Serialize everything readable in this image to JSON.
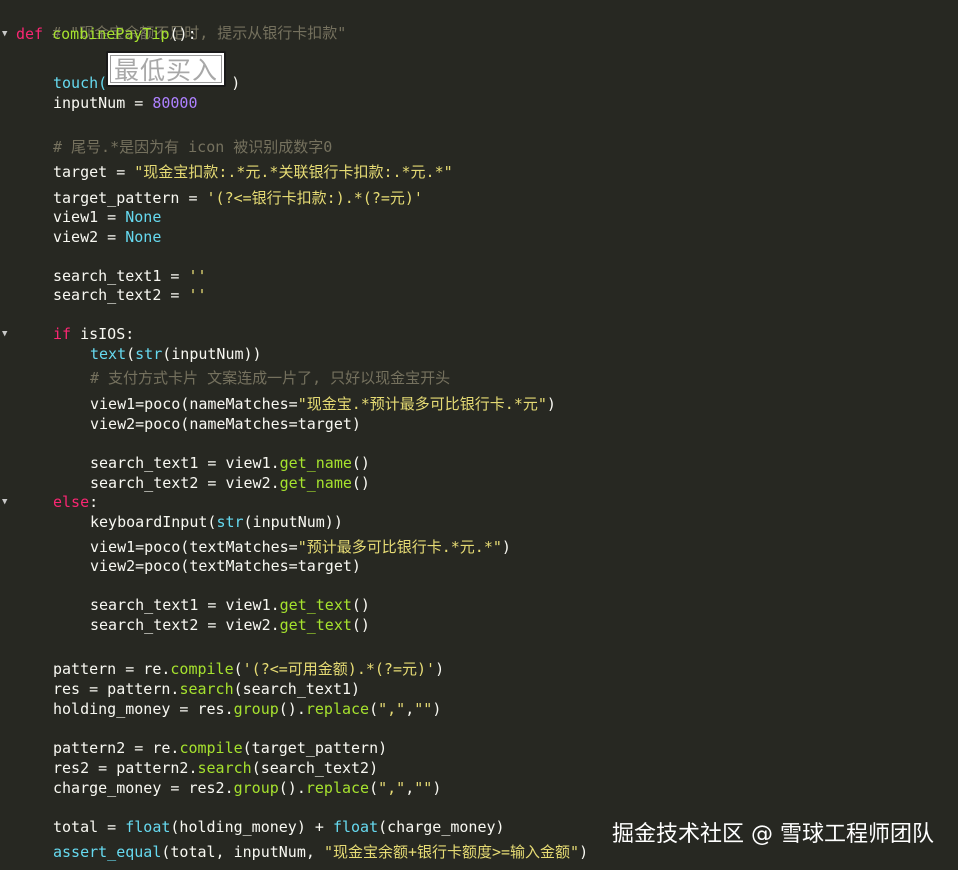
{
  "code": {
    "l01": "# \"现金宝余额不足时, 提示从银行卡扣款\"",
    "l02_kw": "def",
    "l02_fn": "combinePayTip",
    "l02_rest": "():",
    "l03_pre": "touch(",
    "l03_post": ")",
    "l04_pre": "inputNum = ",
    "l04_num": "80000",
    "l05": "# 尾号.*是因为有 icon 被识别成数字0",
    "l06_pre": "target = ",
    "l06_str": "\"现金宝扣款:.*元.*关联银行卡扣款:.*元.*\"",
    "l07_pre": "target_pattern = ",
    "l07_str": "'(?<=银行卡扣款:).*(?=元)'",
    "l08_pre": "view1 = ",
    "l08_none": "None",
    "l09_pre": "view2 = ",
    "l09_none": "None",
    "l10_pre": "search_text1 = ",
    "l10_str": "''",
    "l11_pre": "search_text2 = ",
    "l11_str": "''",
    "l12_kw": "if",
    "l12_rest": " isIOS:",
    "l13_fn": "text",
    "l13_open": "(",
    "l13_bi": "str",
    "l13_rest": "(inputNum))",
    "l14": "# 支付方式卡片 文案连成一片了, 只好以现金宝开头",
    "l15_pre": "view1=poco(nameMatches=",
    "l15_str": "\"现金宝.*预计最多可比银行卡.*元\"",
    "l15_post": ")",
    "l16": "view2=poco(nameMatches=target)",
    "l17_pre": "search_text1 = view1.",
    "l17_fn": "get_name",
    "l17_post": "()",
    "l18_pre": "search_text2 = view2.",
    "l18_fn": "get_name",
    "l18_post": "()",
    "l19_kw": "else",
    "l19_rest": ":",
    "l20_pre": "keyboardInput(",
    "l20_bi": "str",
    "l20_rest": "(inputNum))",
    "l21_pre": "view1=poco(textMatches=",
    "l21_str": "\"预计最多可比银行卡.*元.*\"",
    "l21_post": ")",
    "l22": "view2=poco(textMatches=target)",
    "l23_pre": "search_text1 = view1.",
    "l23_fn": "get_text",
    "l23_post": "()",
    "l24_pre": "search_text2 = view2.",
    "l24_fn": "get_text",
    "l24_post": "()",
    "l25_pre": "pattern = re.",
    "l25_fn": "compile",
    "l25_open": "(",
    "l25_str": "'(?<=可用金额).*(?=元)'",
    "l25_post": ")",
    "l26_pre": "res = pattern.",
    "l26_fn": "search",
    "l26_post": "(search_text1)",
    "l27_pre": "holding_money = res.",
    "l27_fn1": "group",
    "l27_mid": "().",
    "l27_fn2": "replace",
    "l27_open": "(",
    "l27_s1": "\",\"",
    "l27_comma": ",",
    "l27_s2": "\"\"",
    "l27_post": ")",
    "l28_pre": "pattern2 = re.",
    "l28_fn": "compile",
    "l28_post": "(target_pattern)",
    "l29_pre": "res2 = pattern2.",
    "l29_fn": "search",
    "l29_post": "(search_text2)",
    "l30_pre": "charge_money = res2.",
    "l30_fn1": "group",
    "l30_mid": "().",
    "l30_fn2": "replace",
    "l30_open": "(",
    "l30_s1": "\",\"",
    "l30_comma": ",",
    "l30_s2": "\"\"",
    "l30_post": ")",
    "l31_pre": "total = ",
    "l31_bi1": "float",
    "l31_mid": "(holding_money) + ",
    "l31_bi2": "float",
    "l31_post": "(charge_money)",
    "l32_bi": "assert_equal",
    "l32_mid": "(total, inputNum, ",
    "l32_str": "\"现金宝余额+银行卡额度>=输入金额\"",
    "l32_post": ")"
  },
  "touch_image_text": "最低买入",
  "fold_icon": "triangle-down-icon",
  "watermark": "掘金技术社区 @ 雪球工程师团队",
  "colors": {
    "background": "#272822",
    "comment": "#75715e",
    "keyword": "#f92672",
    "function": "#a6e22e",
    "builtin": "#66d9ef",
    "string": "#e6db74",
    "number": "#ae81ff"
  }
}
